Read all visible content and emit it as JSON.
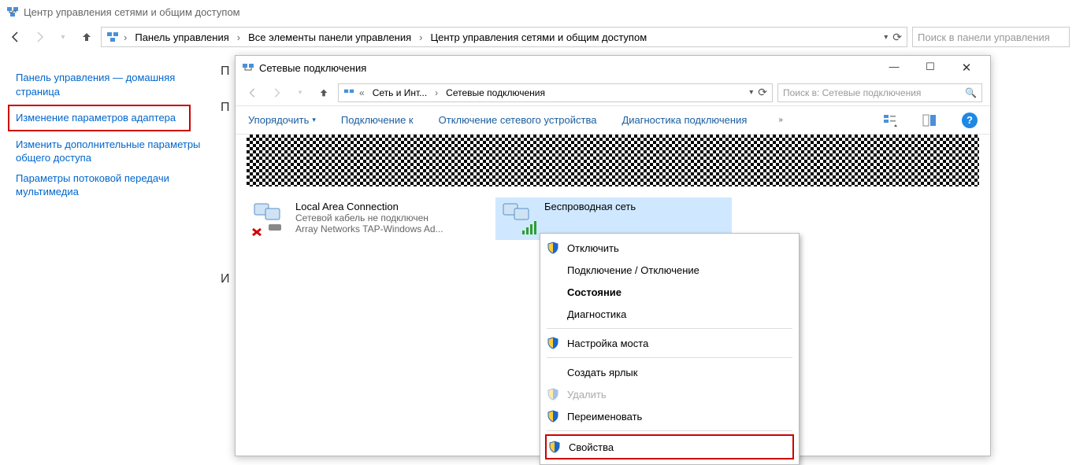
{
  "main": {
    "title": "Центр управления сетями и общим доступом",
    "breadcrumbs": [
      "Панель управления",
      "Все элементы панели управления",
      "Центр управления сетями и общим доступом"
    ],
    "search_placeholder": "Поиск в панели управления"
  },
  "sidebar": {
    "home": "Панель управления — домашняя страница",
    "adapter_settings": "Изменение параметров адаптера",
    "sharing_settings": "Изменить дополнительные параметры общего доступа",
    "media_streaming": "Параметры потоковой передачи мультимедиа"
  },
  "content_hints": {
    "h1": "П",
    "h2": "П",
    "h3": "И"
  },
  "child": {
    "title": "Сетевые подключения",
    "breadcrumbs": [
      "Сеть и Инт...",
      "Сетевые подключения"
    ],
    "search_placeholder": "Поиск в: Сетевые подключения",
    "toolbar": {
      "organize": "Упорядочить",
      "connect": "Подключение к",
      "disable": "Отключение сетевого устройства",
      "diagnose": "Диагностика подключения"
    },
    "adapters": [
      {
        "name": "Local Area Connection",
        "status": "Сетевой кабель не подключен",
        "driver": "Array Networks TAP-Windows Ad..."
      },
      {
        "name": "Беспроводная сеть",
        "status": "",
        "driver": ""
      }
    ]
  },
  "context_menu": {
    "disable": "Отключить",
    "connect_disconnect": "Подключение / Отключение",
    "status": "Состояние",
    "diagnostics": "Диагностика",
    "bridge": "Настройка моста",
    "shortcut": "Создать ярлык",
    "delete": "Удалить",
    "rename": "Переименовать",
    "properties": "Свойства"
  }
}
